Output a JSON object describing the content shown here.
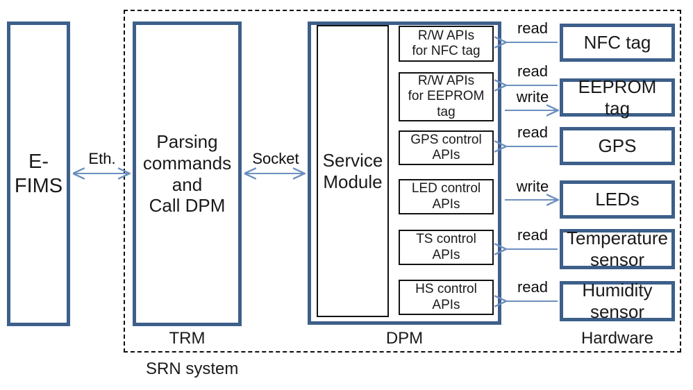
{
  "diagram": {
    "title_caption": "SRN system",
    "accent_color": "#3d5f8a",
    "boundary_color": "#0d0d0d"
  },
  "external": {
    "efims_label": "E-\nFIMS"
  },
  "trm": {
    "box_label": "Parsing\ncommands\nand\nCall DPM",
    "caption": "TRM"
  },
  "dpm": {
    "caption": "DPM",
    "service_module_label": "Service\nModule",
    "api_boxes": [
      {
        "label": "R/W APIs\nfor NFC tag"
      },
      {
        "label": "R/W APIs\nfor EEPROM\ntag"
      },
      {
        "label": "GPS control\nAPIs"
      },
      {
        "label": "LED control\nAPIs"
      },
      {
        "label": "TS control\nAPIs"
      },
      {
        "label": "HS control\nAPIs"
      }
    ]
  },
  "hardware": {
    "caption": "Hardware",
    "devices": [
      {
        "label": "NFC tag"
      },
      {
        "label": "EEPROM tag"
      },
      {
        "label": "GPS"
      },
      {
        "label": "LEDs"
      },
      {
        "label": "Temperature\nsensor"
      },
      {
        "label": "Humidity\nsensor"
      }
    ]
  },
  "links": {
    "efims_to_trm": "Eth.",
    "trm_to_dpm": "Socket",
    "nfc_read": "read",
    "eeprom_read": "read",
    "eeprom_write": "write",
    "gps_read": "read",
    "led_write": "write",
    "temperature_read": "read",
    "humidity_read": "read"
  }
}
